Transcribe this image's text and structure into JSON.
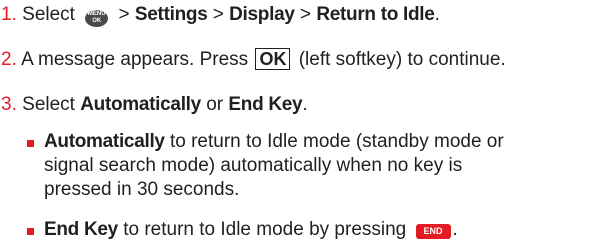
{
  "steps": {
    "s1": {
      "num": "1.",
      "pre": "Select",
      "menu_key_top": "MENU",
      "menu_key_bottom": "OK",
      "path1": "Settings",
      "path2": "Display",
      "path3": "Return to Idle",
      "sep": ">",
      "end": "."
    },
    "s2": {
      "num": "2.",
      "pre": "A message appears. Press",
      "ok_key": "OK",
      "post": "(left softkey) to continue."
    },
    "s3": {
      "num": "3.",
      "pre": "Select",
      "opt1": "Automatically",
      "or": "or",
      "opt2": "End Key",
      "end": "."
    }
  },
  "bullets": {
    "b1": {
      "bold": "Automatically",
      "line1": "to return to Idle mode (standby mode or",
      "line2": "signal search mode) automatically when no key is",
      "line3": "pressed in 30 seconds."
    },
    "b2": {
      "bold": "End Key",
      "text": "to return to Idle mode by pressing",
      "end_key": "END",
      "end": "."
    }
  }
}
